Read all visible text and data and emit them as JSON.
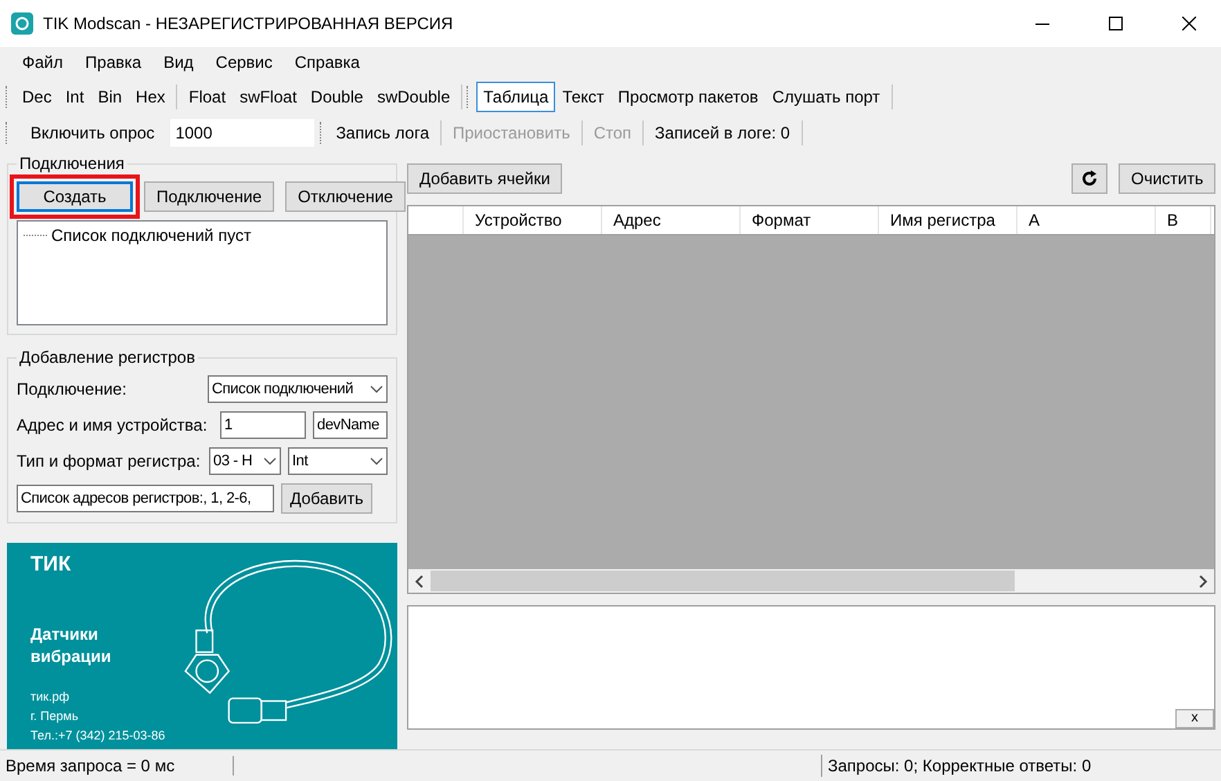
{
  "window": {
    "title": "TIK Modscan - НЕЗАРЕГИСТРИРОВАННАЯ ВЕРСИЯ"
  },
  "menu": [
    "Файл",
    "Правка",
    "Вид",
    "Сервис",
    "Справка"
  ],
  "toolbar_formats": [
    {
      "groups": [
        [
          "Dec",
          "Int",
          "Bin",
          "Hex"
        ],
        [
          "Float",
          "swFloat",
          "Double",
          "swDouble"
        ]
      ]
    }
  ],
  "view_tabs": [
    {
      "label": "Таблица",
      "selected": true
    },
    {
      "label": "Текст",
      "selected": false
    },
    {
      "label": "Просмотр пакетов",
      "selected": false
    },
    {
      "label": "Слушать порт",
      "selected": false
    }
  ],
  "poll_toolbar": {
    "poll_button": "Включить опрос",
    "interval": "1000",
    "actions": [
      {
        "label": "Запись лога",
        "disabled": false
      },
      {
        "label": "Приостановить",
        "disabled": true
      },
      {
        "label": "Стоп",
        "disabled": true
      }
    ],
    "log_count": "Записей в логе: 0"
  },
  "connections": {
    "title": "Подключения",
    "buttons": [
      {
        "label": "Создать",
        "focused": true,
        "highlighted": true
      },
      {
        "label": "Подключение",
        "focused": false,
        "highlighted": false
      },
      {
        "label": "Отключение",
        "focused": false,
        "highlighted": false
      }
    ],
    "tree_items": [
      "Список подключений пуст"
    ]
  },
  "add_registers": {
    "title": "Добавление регистров",
    "connection_label": "Подключение:",
    "connection_value": "Список подключений",
    "device_label": "Адрес и имя устройства:",
    "device_address": "1",
    "device_name": "devName",
    "type_label": "Тип и формат регистра:",
    "register_type": "03 - H",
    "register_format": "Int",
    "address_list": "Список адресов регистров:, 1, 2-6,",
    "add_button": "Добавить"
  },
  "banner": {
    "logo": "ТИК",
    "headline": [
      "Датчики",
      "вибрации"
    ],
    "contacts": [
      "тик.рф",
      "г. Пермь",
      "Тел.:+7 (342) 215-03-86"
    ]
  },
  "table": {
    "add_button": "Добавить ячейки",
    "clear_button": "Очистить",
    "columns": [
      "",
      "Устройство",
      "Адрес",
      "Формат",
      "Имя регистра",
      "A",
      "B"
    ]
  },
  "log_panel": {
    "close_button": "x"
  },
  "status_bar": {
    "left": "Время запроса = 0 мс",
    "right": "Запросы: 0; Корректные ответы: 0"
  }
}
